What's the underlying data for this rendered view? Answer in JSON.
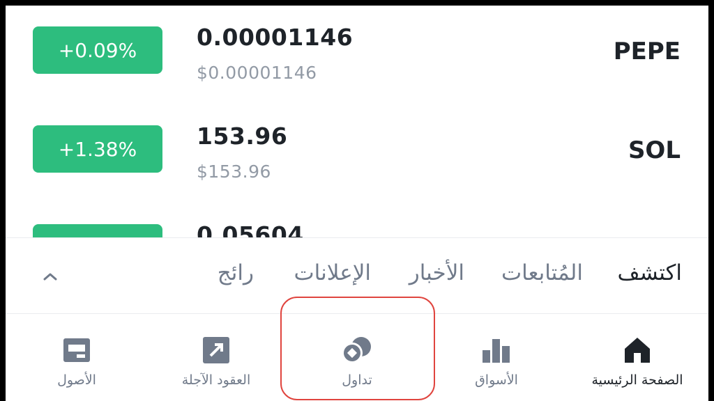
{
  "coins": [
    {
      "symbol": "PEPE",
      "price": "0.00001146",
      "usd": "$0.00001146",
      "change": "+0.09%"
    },
    {
      "symbol": "SOL",
      "price": "153.96",
      "usd": "$153.96",
      "change": "+1.38%"
    },
    {
      "symbol": "",
      "price": "0.05604",
      "usd": "",
      "change": ""
    }
  ],
  "tabs": {
    "discover": "اكتشف",
    "following": "المُتابعات",
    "news": "الأخبار",
    "announcements": "الإعلانات",
    "trending": "رائج"
  },
  "nav": {
    "home": "الصفحة الرئيسية",
    "markets": "الأسواق",
    "trade": "تداول",
    "futures": "العقود الآجلة",
    "assets": "الأصول"
  },
  "colors": {
    "positive": "#2dbd7e",
    "highlight": "#e0443e",
    "text": "#1e2329",
    "muted": "#707a8a"
  },
  "icons": {
    "collapse": "chevron-up-icon",
    "home": "home-icon",
    "markets": "bar-chart-icon",
    "trade": "coins-icon",
    "futures": "futures-icon",
    "assets": "wallet-icon"
  }
}
